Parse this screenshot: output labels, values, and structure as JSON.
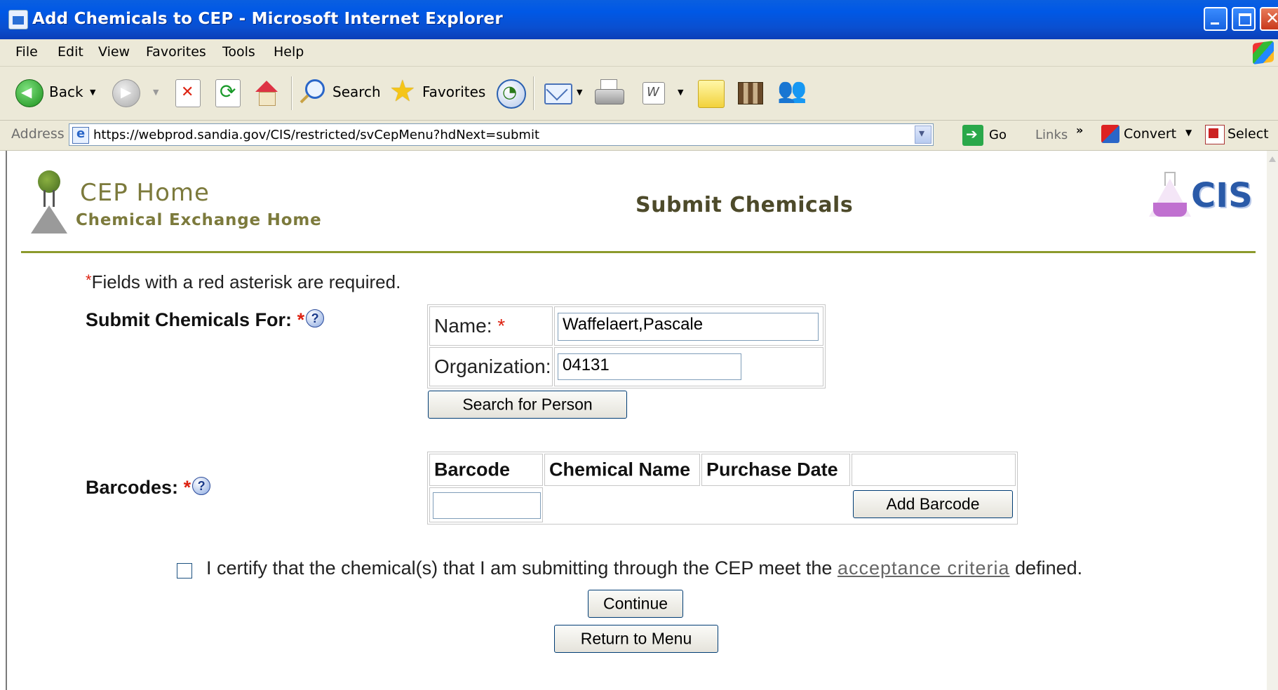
{
  "window": {
    "title": "Add Chemicals to CEP - Microsoft Internet Explorer"
  },
  "menu": [
    "File",
    "Edit",
    "View",
    "Favorites",
    "Tools",
    "Help"
  ],
  "toolbar": {
    "back_label": "Back",
    "search_label": "Search",
    "favorites_label": "Favorites"
  },
  "address_bar": {
    "label": "Address",
    "url": "https://webprod.sandia.gov/CIS/restricted/svCepMenu?hdNext=submit",
    "go_label": "Go",
    "links_label": "Links",
    "convert_label": "Convert",
    "select_label": "Select"
  },
  "header": {
    "home_title": "CEP Home",
    "home_subtitle": "Chemical Exchange Home",
    "page_title": "Submit Chemicals",
    "logo_text": "CIS"
  },
  "form": {
    "required_note": "Fields with a red asterisk are required.",
    "submit_for_label": "Submit Chemicals For:",
    "name_label": "Name:",
    "name_value": "Waffelaert,Pascale",
    "org_label": "Organization:",
    "org_value": "04131",
    "search_person_button": "Search for Person",
    "barcodes_label": "Barcodes:",
    "barcode_columns": [
      "Barcode",
      "Chemical Name",
      "Purchase Date"
    ],
    "barcode_value": "",
    "add_barcode_button": "Add Barcode",
    "certify_text_before": "I certify that the chemical(s) that I am submitting through the CEP meet the",
    "certify_link": "acceptance criteria",
    "certify_text_after": "defined.",
    "certify_checked": false,
    "continue_button": "Continue",
    "return_button": "Return to Menu"
  },
  "colors": {
    "titlebar_blue": "#0058e6",
    "header_olive": "#7c7a3c",
    "divider_green": "#8c9a2c",
    "required_red": "#dd2211"
  },
  "icons": [
    "back-icon",
    "forward-icon",
    "stop-icon",
    "refresh-icon",
    "home-icon",
    "search-icon",
    "favorites-star-icon",
    "history-icon",
    "mail-icon",
    "print-icon",
    "edit-word-icon",
    "note-icon",
    "research-icon",
    "messenger-icon",
    "help-icon",
    "flask-logo-icon",
    "cis-logo-icon"
  ]
}
